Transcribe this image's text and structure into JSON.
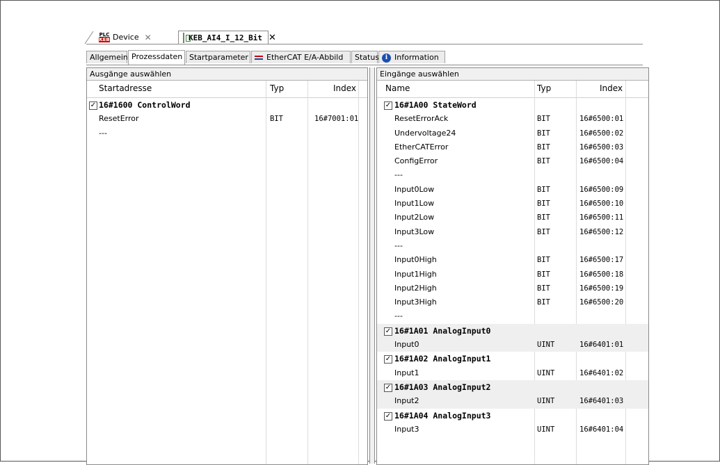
{
  "doc_tabs": {
    "device": {
      "icon_top": "PLC",
      "icon_bottom": "KEB",
      "label": "Device",
      "close": "✕"
    },
    "module": {
      "label": "KEB_AI4_I_12_Bit",
      "close": "✕"
    }
  },
  "sub_tabs": [
    "Allgemein",
    "Prozessdaten",
    "Startparameter",
    "EtherCAT E/A-Abbild",
    "Status",
    "Information"
  ],
  "outputs": {
    "title": "Ausgänge auswählen",
    "headers": {
      "name": "Startadresse",
      "typ": "Typ",
      "index": "Index"
    },
    "rows": [
      {
        "group": true,
        "checked": "✓",
        "name": "16#1600 ControlWord",
        "typ": "",
        "index": ""
      },
      {
        "group": false,
        "name": "ResetError",
        "typ": "BIT",
        "index": "16#7001:01"
      },
      {
        "group": false,
        "name": "---",
        "typ": "",
        "index": ""
      }
    ]
  },
  "inputs": {
    "title": "Eingänge auswählen",
    "headers": {
      "name": "Name",
      "typ": "Typ",
      "index": "Index"
    },
    "rows": [
      {
        "group": true,
        "checked": "✓",
        "name": "16#1A00 StateWord",
        "typ": "",
        "index": ""
      },
      {
        "group": false,
        "name": "ResetErrorAck",
        "typ": "BIT",
        "index": "16#6500:01"
      },
      {
        "group": false,
        "name": "Undervoltage24",
        "typ": "BIT",
        "index": "16#6500:02"
      },
      {
        "group": false,
        "name": "EtherCATError",
        "typ": "BIT",
        "index": "16#6500:03"
      },
      {
        "group": false,
        "name": "ConfigError",
        "typ": "BIT",
        "index": "16#6500:04"
      },
      {
        "group": false,
        "name": "---",
        "typ": "",
        "index": ""
      },
      {
        "group": false,
        "name": "Input0Low",
        "typ": "BIT",
        "index": "16#6500:09"
      },
      {
        "group": false,
        "name": "Input1Low",
        "typ": "BIT",
        "index": "16#6500:10"
      },
      {
        "group": false,
        "name": "Input2Low",
        "typ": "BIT",
        "index": "16#6500:11"
      },
      {
        "group": false,
        "name": "Input3Low",
        "typ": "BIT",
        "index": "16#6500:12"
      },
      {
        "group": false,
        "name": "---",
        "typ": "",
        "index": ""
      },
      {
        "group": false,
        "name": "Input0High",
        "typ": "BIT",
        "index": "16#6500:17"
      },
      {
        "group": false,
        "name": "Input1High",
        "typ": "BIT",
        "index": "16#6500:18"
      },
      {
        "group": false,
        "name": "Input2High",
        "typ": "BIT",
        "index": "16#6500:19"
      },
      {
        "group": false,
        "name": "Input3High",
        "typ": "BIT",
        "index": "16#6500:20"
      },
      {
        "group": false,
        "name": "---",
        "typ": "",
        "index": ""
      },
      {
        "group": true,
        "shade": true,
        "checked": "✓",
        "name": "16#1A01 AnalogInput0",
        "typ": "",
        "index": ""
      },
      {
        "group": false,
        "shade": true,
        "name": "Input0",
        "typ": "UINT",
        "index": "16#6401:01"
      },
      {
        "group": true,
        "checked": "✓",
        "name": "16#1A02 AnalogInput1",
        "typ": "",
        "index": ""
      },
      {
        "group": false,
        "name": "Input1",
        "typ": "UINT",
        "index": "16#6401:02"
      },
      {
        "group": true,
        "shade": true,
        "checked": "✓",
        "name": "16#1A03 AnalogInput2",
        "typ": "",
        "index": ""
      },
      {
        "group": false,
        "shade": true,
        "name": "Input2",
        "typ": "UINT",
        "index": "16#6401:03"
      },
      {
        "group": true,
        "checked": "✓",
        "name": "16#1A04 AnalogInput3",
        "typ": "",
        "index": ""
      },
      {
        "group": false,
        "name": "Input3",
        "typ": "UINT",
        "index": "16#6401:04"
      }
    ]
  }
}
